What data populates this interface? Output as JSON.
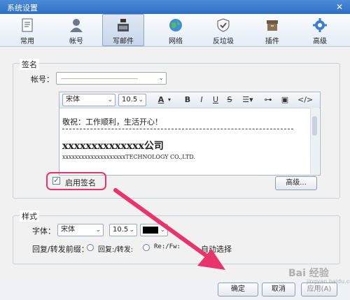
{
  "window": {
    "title": "系统设置",
    "close_glyph": "✕"
  },
  "toolbar": {
    "items": [
      {
        "label": "常用",
        "icon": "document-icon"
      },
      {
        "label": "帐号",
        "icon": "user-icon"
      },
      {
        "label": "写邮件",
        "icon": "ink-bottle-icon",
        "active": true
      },
      {
        "label": "网络",
        "icon": "globe-icon"
      },
      {
        "label": "反垃圾",
        "icon": "shield-icon"
      },
      {
        "label": "插件",
        "icon": "box-icon"
      },
      {
        "label": "高级",
        "icon": "gear-icon"
      }
    ]
  },
  "signature": {
    "group_title": "签名",
    "account_label": "帐号：",
    "account_value": "",
    "font_name": "宋体",
    "font_size": "10.5",
    "editor_buttons": {
      "font_color": "A",
      "bold": "B",
      "italic": "I",
      "underline": "U",
      "strike": "S",
      "code": "</>"
    },
    "line1": "敬祝：工作顺利，生活开心！",
    "company": "xxxxxxxxxxxxxx公司",
    "english": "xxxxxxxxxxxxxxxxxxxxTECHNOLOGY CO.,LTD.",
    "enable_label": "启用签名",
    "enable_checked": true,
    "check_glyph": "✓",
    "advanced_button": "高级..."
  },
  "style": {
    "group_title": "样式",
    "font_label": "字体：",
    "font_name": "宋体",
    "font_size": "10.5",
    "reply_prefix_label": "回复/转发前缀：",
    "option1": "回复:/转发:",
    "option2": "Re:/Fw:",
    "option3": "自动选择"
  },
  "footer": {
    "ok": "确定",
    "cancel": "取消",
    "apply": "应用(A)"
  },
  "watermark": {
    "text": "Bai 经验",
    "sub": "jingyan.baidu.com"
  },
  "colors": {
    "annotation": "#e8336b",
    "titlebar": "#2e6fc4",
    "font_color_swatch": "#000000"
  }
}
